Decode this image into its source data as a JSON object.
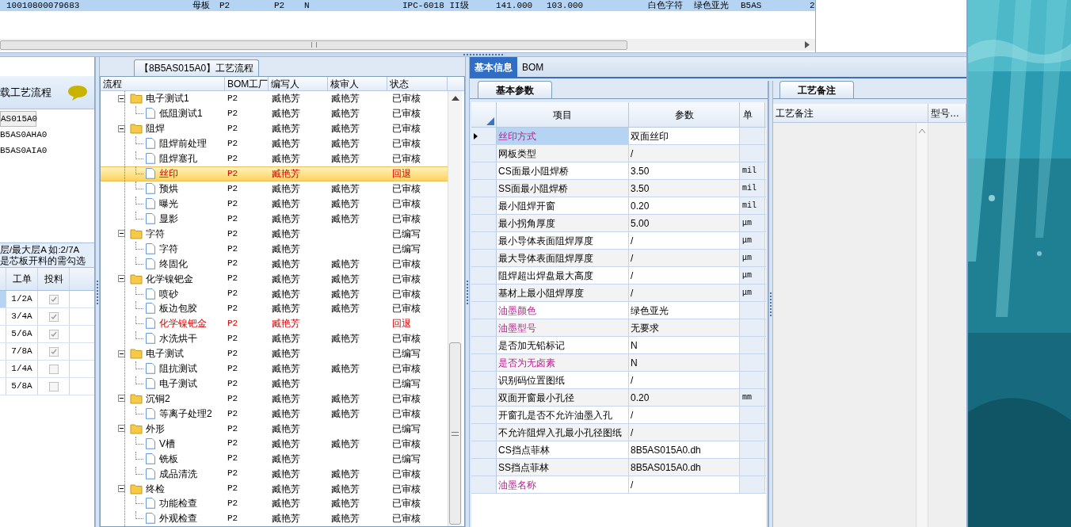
{
  "top_grid": {
    "rows": [
      {
        "selected": true,
        "cells": [
          "10010800079683",
          "母板",
          "P2",
          "P2",
          "N",
          "IPC-6018 II级",
          "141.000",
          "103.000",
          "白色字符",
          "绿色亚光",
          "B5AS",
          "2"
        ]
      }
    ]
  },
  "left_panel": {
    "title": "载工艺流程",
    "items": [
      {
        "label": "AS015A0",
        "selected": true
      },
      {
        "label": "B5AS0AHA0",
        "selected": false
      },
      {
        "label": "B5AS0AIA0",
        "selected": false
      }
    ],
    "notes": [
      "层/最大层A 如:2/7A",
      "是芯板开料的需勾选"
    ],
    "table": {
      "columns": [
        "工单",
        "投料"
      ],
      "rows": [
        {
          "order": "1/2A",
          "checked": true,
          "selected": true
        },
        {
          "order": "3/4A",
          "checked": true,
          "selected": false
        },
        {
          "order": "5/6A",
          "checked": true,
          "selected": false
        },
        {
          "order": "7/8A",
          "checked": true,
          "selected": false
        },
        {
          "order": "1/4A",
          "checked": false,
          "selected": false
        },
        {
          "order": "5/8A",
          "checked": false,
          "selected": false
        }
      ]
    }
  },
  "process_panel": {
    "tab": "【8B5AS015A0】工艺流程",
    "columns": [
      "流程",
      "BOM工厂",
      "编写人",
      "核审人",
      "状态"
    ],
    "tree": [
      {
        "label": "电子测试1",
        "bom": "P2",
        "writer": "臧艳芳",
        "reviewer": "臧艳芳",
        "status": "已审核",
        "expanded": true,
        "selected": false,
        "returned": false,
        "children": [
          {
            "label": "低阻测试1",
            "bom": "P2",
            "writer": "臧艳芳",
            "reviewer": "臧艳芳",
            "status": "已审核",
            "selected": false,
            "returned": false
          }
        ]
      },
      {
        "label": "阻焊",
        "bom": "P2",
        "writer": "臧艳芳",
        "reviewer": "臧艳芳",
        "status": "已审核",
        "expanded": true,
        "selected": false,
        "returned": false,
        "children": [
          {
            "label": "阻焊前处理",
            "bom": "P2",
            "writer": "臧艳芳",
            "reviewer": "臧艳芳",
            "status": "已审核",
            "selected": false,
            "returned": false
          },
          {
            "label": "阻焊塞孔",
            "bom": "P2",
            "writer": "臧艳芳",
            "reviewer": "臧艳芳",
            "status": "已审核",
            "selected": false,
            "returned": false
          },
          {
            "label": "丝印",
            "bom": "P2",
            "writer": "臧艳芳",
            "status": "回退",
            "selected": true,
            "returned": true
          },
          {
            "label": "预烘",
            "bom": "P2",
            "writer": "臧艳芳",
            "reviewer": "臧艳芳",
            "status": "已审核",
            "selected": false,
            "returned": false
          },
          {
            "label": "曝光",
            "bom": "P2",
            "writer": "臧艳芳",
            "reviewer": "臧艳芳",
            "status": "已审核",
            "selected": false,
            "returned": false
          },
          {
            "label": "显影",
            "bom": "P2",
            "writer": "臧艳芳",
            "reviewer": "臧艳芳",
            "status": "已审核",
            "selected": false,
            "returned": false
          }
        ]
      },
      {
        "label": "字符",
        "bom": "P2",
        "writer": "臧艳芳",
        "status": "已编写",
        "expanded": true,
        "selected": false,
        "returned": false,
        "children": [
          {
            "label": "字符",
            "bom": "P2",
            "writer": "臧艳芳",
            "status": "已编写",
            "selected": false,
            "returned": false
          },
          {
            "label": "终固化",
            "bom": "P2",
            "writer": "臧艳芳",
            "reviewer": "臧艳芳",
            "status": "已审核",
            "selected": false,
            "returned": false
          }
        ]
      },
      {
        "label": "化学镍钯金",
        "bom": "P2",
        "writer": "臧艳芳",
        "reviewer": "臧艳芳",
        "status": "已审核",
        "expanded": true,
        "selected": false,
        "returned": false,
        "children": [
          {
            "label": "喷砂",
            "bom": "P2",
            "writer": "臧艳芳",
            "reviewer": "臧艳芳",
            "status": "已审核",
            "selected": false,
            "returned": false
          },
          {
            "label": "板边包胶",
            "bom": "P2",
            "writer": "臧艳芳",
            "reviewer": "臧艳芳",
            "status": "已审核",
            "selected": false,
            "returned": false
          },
          {
            "label": "化学镍钯金",
            "bom": "P2",
            "writer": "臧艳芳",
            "status": "回退",
            "selected": false,
            "returned": true
          },
          {
            "label": "水洗烘干",
            "bom": "P2",
            "writer": "臧艳芳",
            "reviewer": "臧艳芳",
            "status": "已审核",
            "selected": false,
            "returned": false
          }
        ]
      },
      {
        "label": "电子测试",
        "bom": "P2",
        "writer": "臧艳芳",
        "status": "已编写",
        "expanded": true,
        "selected": false,
        "returned": false,
        "children": [
          {
            "label": "阻抗测试",
            "bom": "P2",
            "writer": "臧艳芳",
            "reviewer": "臧艳芳",
            "status": "已审核",
            "selected": false,
            "returned": false
          },
          {
            "label": "电子测试",
            "bom": "P2",
            "writer": "臧艳芳",
            "status": "已编写",
            "selected": false,
            "returned": false
          }
        ]
      },
      {
        "label": "沉铜2",
        "bom": "P2",
        "writer": "臧艳芳",
        "reviewer": "臧艳芳",
        "status": "已审核",
        "expanded": true,
        "selected": false,
        "returned": false,
        "children": [
          {
            "label": "等离子处理2",
            "bom": "P2",
            "writer": "臧艳芳",
            "reviewer": "臧艳芳",
            "status": "已审核",
            "selected": false,
            "returned": false
          }
        ]
      },
      {
        "label": "外形",
        "bom": "P2",
        "writer": "臧艳芳",
        "status": "已编写",
        "expanded": true,
        "selected": false,
        "returned": false,
        "children": [
          {
            "label": "V槽",
            "bom": "P2",
            "writer": "臧艳芳",
            "reviewer": "臧艳芳",
            "status": "已审核",
            "selected": false,
            "returned": false
          },
          {
            "label": "铣板",
            "bom": "P2",
            "writer": "臧艳芳",
            "status": "已编写",
            "selected": false,
            "returned": false
          },
          {
            "label": "成品清洗",
            "bom": "P2",
            "writer": "臧艳芳",
            "reviewer": "臧艳芳",
            "status": "已审核",
            "selected": false,
            "returned": false
          }
        ]
      },
      {
        "label": "终检",
        "bom": "P2",
        "writer": "臧艳芳",
        "reviewer": "臧艳芳",
        "status": "已审核",
        "expanded": true,
        "selected": false,
        "returned": false,
        "children": [
          {
            "label": "功能检查",
            "bom": "P2",
            "writer": "臧艳芳",
            "reviewer": "臧艳芳",
            "status": "已审核",
            "selected": false,
            "returned": false
          },
          {
            "label": "外观检查",
            "bom": "P2",
            "writer": "臧艳芳",
            "reviewer": "臧艳芳",
            "status": "已审核",
            "selected": false,
            "returned": false
          }
        ]
      }
    ]
  },
  "info_panel": {
    "tabs": [
      {
        "label": "基本信息",
        "selected": true
      },
      {
        "label": "BOM",
        "selected": false
      }
    ],
    "params": {
      "tab": "基本参数",
      "columns": [
        "项目",
        "参数",
        "单"
      ],
      "rows": [
        {
          "item": "丝印方式",
          "value": "双面丝印",
          "highlight": true,
          "current": true
        },
        {
          "item": "网板类型",
          "value": "/",
          "highlight": false,
          "current": false
        },
        {
          "item": "CS面最小阻焊桥",
          "value": "3.50",
          "unit": "mil",
          "highlight": false,
          "current": false
        },
        {
          "item": "SS面最小阻焊桥",
          "value": "3.50",
          "unit": "mil",
          "highlight": false,
          "current": false
        },
        {
          "item": "最小阻焊开窗",
          "value": "0.20",
          "unit": "mil",
          "highlight": false,
          "current": false
        },
        {
          "item": "最小拐角厚度",
          "value": "5.00",
          "unit": "μm",
          "highlight": false,
          "current": false
        },
        {
          "item": "最小导体表面阻焊厚度",
          "value": "/",
          "unit": "μm",
          "highlight": false,
          "current": false
        },
        {
          "item": "最大导体表面阻焊厚度",
          "value": "/",
          "unit": "μm",
          "highlight": false,
          "current": false
        },
        {
          "item": "阻焊超出焊盘最大高度",
          "value": "/",
          "unit": "μm",
          "highlight": false,
          "current": false
        },
        {
          "item": "基材上最小阻焊厚度",
          "value": "/",
          "unit": "μm",
          "highlight": false,
          "current": false
        },
        {
          "item": "油墨颜色",
          "value": "绿色亚光",
          "highlight": true,
          "current": false
        },
        {
          "item": "油墨型号",
          "value": "无要求",
          "highlight": true,
          "current": false
        },
        {
          "item": "是否加无铅标记",
          "value": "N",
          "highlight": false,
          "current": false
        },
        {
          "item": "是否为无卤素",
          "value": "N",
          "highlight": true,
          "current": false
        },
        {
          "item": "识别码位置图纸",
          "value": "/",
          "highlight": false,
          "current": false
        },
        {
          "item": "双面开窗最小孔径",
          "value": "0.20",
          "unit": "mm",
          "highlight": false,
          "current": false
        },
        {
          "item": "开窗孔是否不允许油墨入孔",
          "value": "/",
          "highlight": false,
          "current": false
        },
        {
          "item": "不允许阻焊入孔最小孔径图纸",
          "value": "/",
          "highlight": false,
          "current": false
        },
        {
          "item": "CS挡点菲林",
          "value": "8B5AS015A0.dh",
          "highlight": false,
          "current": false
        },
        {
          "item": "SS挡点菲林",
          "value": "8B5AS015A0.dh",
          "highlight": false,
          "current": false
        },
        {
          "item": "油墨名称",
          "value": "/",
          "highlight": true,
          "current": false
        }
      ]
    },
    "remarks": {
      "tab": "工艺备注",
      "columns": [
        "工艺备注",
        "型号…"
      ]
    }
  }
}
